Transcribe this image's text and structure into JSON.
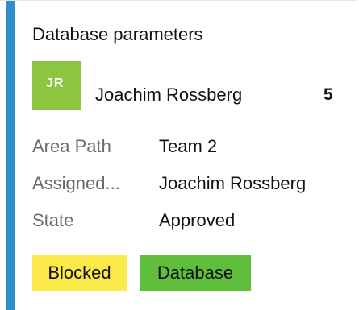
{
  "card": {
    "title": "Database parameters",
    "accent_color": "#2c8fc7",
    "assignee": {
      "initials": "JR",
      "name": "Joachim Rossberg",
      "avatar_color": "#8cc63e"
    },
    "story_points": "5",
    "fields": [
      {
        "label": "Area Path",
        "value": "Team 2"
      },
      {
        "label": "Assigned...",
        "value": "Joachim Rossberg"
      },
      {
        "label": "State",
        "value": "Approved"
      }
    ],
    "tags": [
      {
        "label": "Blocked",
        "color": "#fbe94a"
      },
      {
        "label": "Database",
        "color": "#5fbe3c"
      }
    ]
  }
}
